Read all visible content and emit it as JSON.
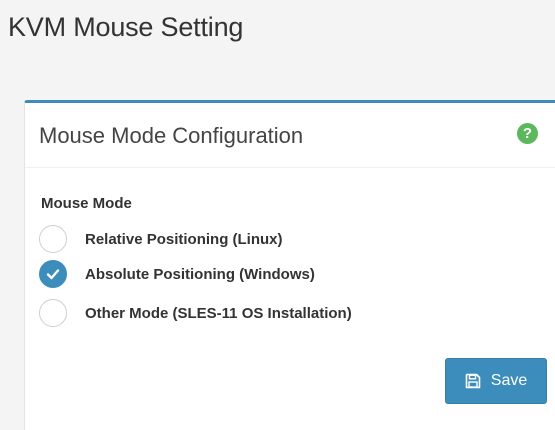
{
  "page": {
    "title": "KVM Mouse Setting"
  },
  "panel": {
    "title": "Mouse Mode Configuration",
    "help_icon": "question-circle-icon",
    "accent_color": "#3c8dbc"
  },
  "mouse_mode": {
    "label": "Mouse Mode",
    "options": [
      {
        "label": "Relative Positioning (Linux)",
        "checked": false
      },
      {
        "label": "Absolute Positioning (Windows)",
        "checked": true
      },
      {
        "label": "Other Mode (SLES-11 OS Installation)",
        "checked": false
      }
    ],
    "selected": "Absolute Positioning (Windows)"
  },
  "actions": {
    "save_label": "Save",
    "save_icon": "floppy-disk-icon",
    "save_color": "#3c8dbc"
  },
  "colors": {
    "help_icon": "#5cb85c",
    "background": "#f4f4f4"
  }
}
